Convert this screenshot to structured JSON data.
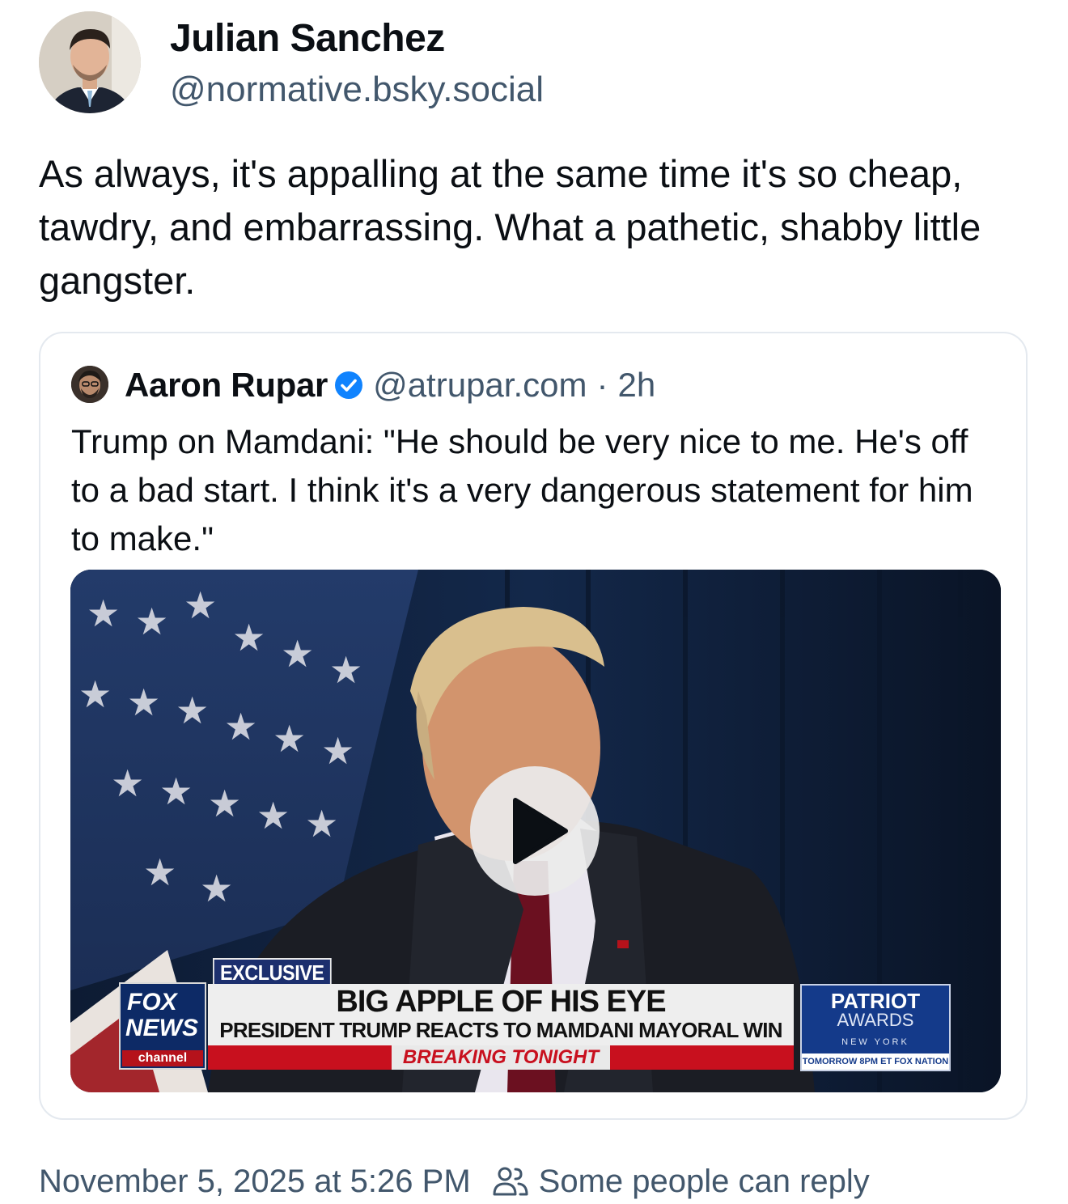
{
  "post": {
    "author": {
      "name": "Julian Sanchez",
      "handle": "@normative.bsky.social"
    },
    "text": "As always, it's appalling at the same time it's so cheap, tawdry, and embarrassing.  What a pathetic, shabby little gangster.",
    "timestamp": "November 5, 2025 at 5:26 PM",
    "reply_setting": "Some people can reply",
    "reply_icon": "people-icon"
  },
  "quote": {
    "author": {
      "name": "Aaron Rupar",
      "verified": true,
      "handle": "@atrupar.com",
      "separator": "·",
      "time": "2h"
    },
    "text": "Trump on Mamdani: \"He should be very nice to me. He's off to a bad start. I think it's a very dangerous statement for him to make.\"",
    "video": {
      "play_icon": "play-icon",
      "overlay": {
        "tag": "EXCLUSIVE",
        "network_line1": "FOX",
        "network_line2": "NEWS",
        "network_line3": "channel",
        "headline": "BIG APPLE OF HIS EYE",
        "subheadline": "PRESIDENT TRUMP REACTS TO MAMDANI MAYORAL WIN",
        "breaking": "BREAKING TONIGHT",
        "promo_title": "PATRIOT",
        "promo_subtitle": "AWARDS",
        "promo_location": "NEW YORK",
        "promo_time": "TOMORROW 8PM ET FOX NATION"
      }
    }
  },
  "colors": {
    "text": "#0b0f14",
    "secondary": "#42576c",
    "verified": "#1083fe",
    "border": "#e4e9ef"
  }
}
